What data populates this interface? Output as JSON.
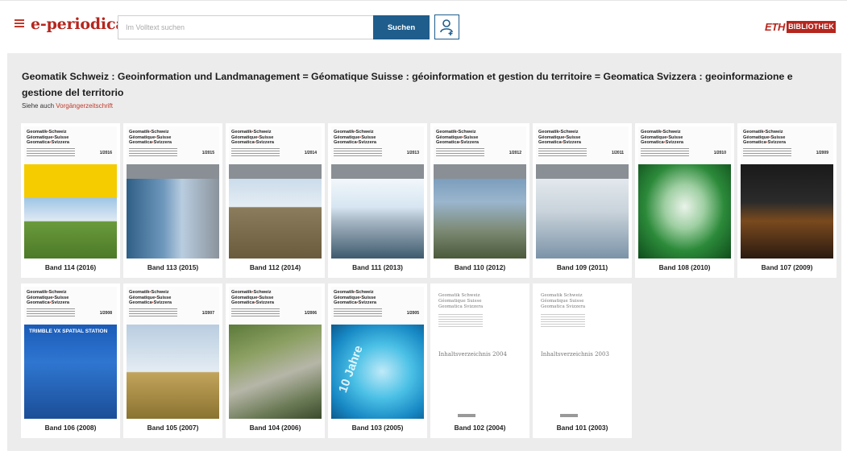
{
  "header": {
    "logo": "e-periodica",
    "search_placeholder": "Im Volltext suchen",
    "search_button": "Suchen",
    "eth_label": "ETH",
    "bib_label": "BIBLIOTHEK"
  },
  "journal": {
    "title": "Geomatik Schweiz : Geoinformation und Landmanagement = Géomatique Suisse : géoinformation et gestion du territoire = Geomatica Svizzera : geoinformazione e gestione del territorio",
    "see_also_prefix": "Siehe auch",
    "see_also_link": "Vorgängerzeitschrift"
  },
  "cover_brand": [
    "Geomatik",
    "Schweiz",
    "Géomatique",
    "Suisse",
    "Geomatica",
    "Svizzera"
  ],
  "volumes": [
    {
      "label": "Band 114 (2016)",
      "issue": "1/2016",
      "theme": "yellow"
    },
    {
      "label": "Band 113 (2015)",
      "issue": "1/2015",
      "theme": "building"
    },
    {
      "label": "Band 112 (2014)",
      "issue": "1/2014",
      "theme": "surveyor-hiker"
    },
    {
      "label": "Band 111 (2013)",
      "issue": "1/2013",
      "theme": "surveyor-orange"
    },
    {
      "label": "Band 110 (2012)",
      "issue": "1/2012",
      "theme": "total-station"
    },
    {
      "label": "Band 109 (2011)",
      "issue": "1/2011",
      "theme": "gps-devices"
    },
    {
      "label": "Band 108 (2010)",
      "issue": "1/2010",
      "theme": "gnss-antenna"
    },
    {
      "label": "Band 107 (2009)",
      "issue": "1/2009",
      "theme": "worker-dark"
    },
    {
      "label": "Band 106 (2008)",
      "issue": "1/2008",
      "theme": "trimble-vx",
      "banner": "TRIMBLE VX SPATIAL STATION"
    },
    {
      "label": "Band 105 (2007)",
      "issue": "1/2007",
      "theme": "field-station"
    },
    {
      "label": "Band 104 (2006)",
      "issue": "1/2006",
      "theme": "aerial"
    },
    {
      "label": "Band 103 (2005)",
      "issue": "1/2005",
      "theme": "ten-years",
      "banner": "10 Jahre"
    },
    {
      "label": "Band 102 (2004)",
      "theme": "index",
      "index_title": "Inhaltsverzeichnis 2004",
      "index_head": [
        "Geomatik Schweiz",
        "Géomatique Suisse",
        "Geomatica Svizzera"
      ]
    },
    {
      "label": "Band 101 (2003)",
      "theme": "index",
      "index_title": "Inhaltsverzeichnis 2003",
      "index_head": [
        "Geomatik Schweiz",
        "Géomatique Suisse",
        "Geomatica Svizzera"
      ]
    }
  ],
  "colors": {
    "brand_red": "#b5261e",
    "search_blue": "#1f5d8c",
    "panel_gray": "#ececec"
  }
}
